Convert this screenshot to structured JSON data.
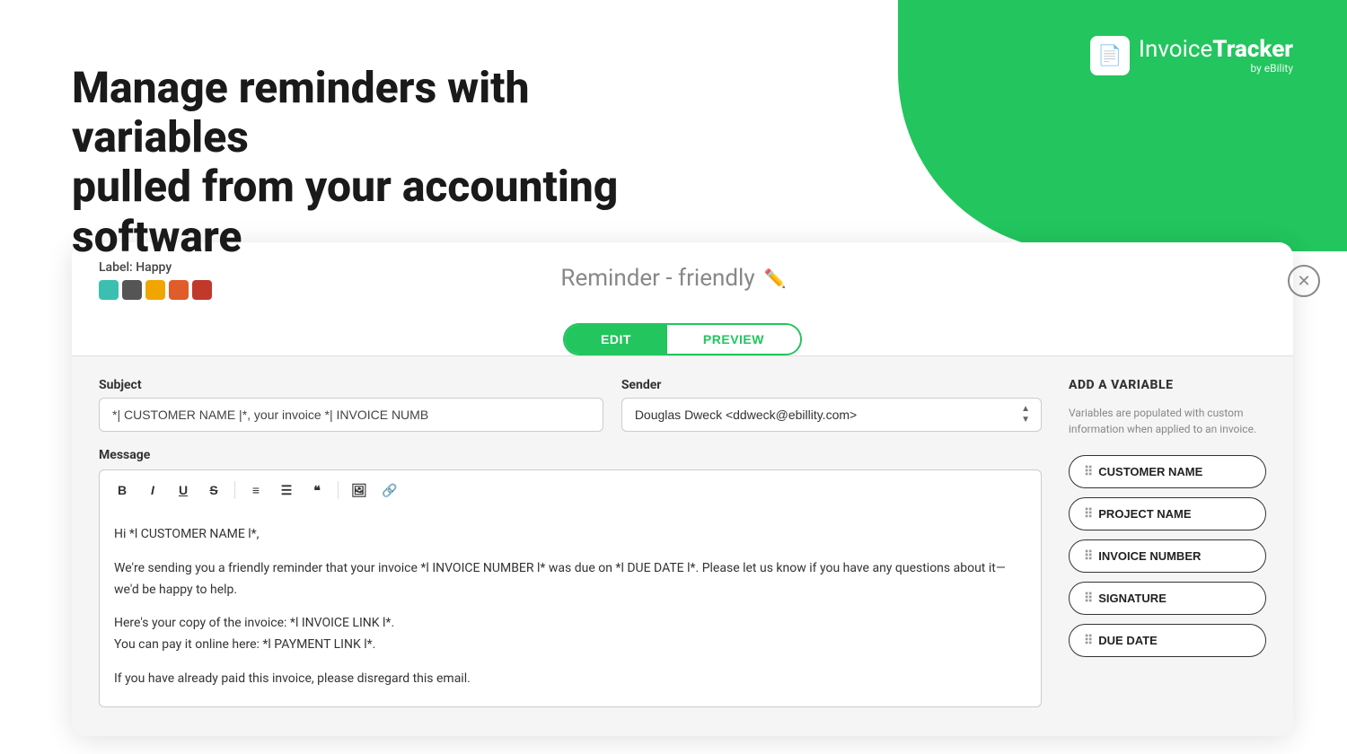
{
  "app": {
    "logo_icon": "📄",
    "logo_name_prefix": "Invoice",
    "logo_name_suffix": "Tracker",
    "logo_by": "by eBility"
  },
  "hero": {
    "heading_line1": "Manage reminders with variables",
    "heading_line2": "pulled from your accounting software"
  },
  "card": {
    "label_text": "Label: Happy",
    "swatches": [
      {
        "color": "#3bbfb0",
        "name": "teal"
      },
      {
        "color": "#7ab648",
        "name": "dark-gray"
      },
      {
        "color": "#f0a500",
        "name": "yellow"
      },
      {
        "color": "#e05c2a",
        "name": "orange"
      },
      {
        "color": "#c0392b",
        "name": "red"
      }
    ],
    "reminder_title": "Reminder - friendly",
    "tabs": {
      "edit_label": "EDIT",
      "preview_label": "PREVIEW",
      "active": "edit"
    },
    "form": {
      "subject_label": "Subject",
      "subject_value": "*| CUSTOMER NAME |*, your invoice *| INVOICE NUMB",
      "sender_label": "Sender",
      "sender_value": "Douglas Dweck <ddweck@ebillity.com>"
    },
    "message": {
      "label": "Message",
      "toolbar_buttons": [
        "B",
        "I",
        "U",
        "S",
        "ol",
        "ul",
        "quote",
        "img",
        "link"
      ],
      "body_line1": "Hi *l CUSTOMER NAME l*,",
      "body_line2": "We're sending you a friendly reminder that your invoice *l INVOICE NUMBER l* was due on *l DUE DATE l*. Please let us know if you have any questions about it—we'd be happy to help.",
      "body_line3": "Here's your copy of the invoice: *l INVOICE LINK l*.",
      "body_line4": "You can pay it online here: *l PAYMENT LINK l*.",
      "body_line5": "If you have already paid this invoice, please disregard this email."
    },
    "add_variable": {
      "title": "ADD A VARIABLE",
      "description": "Variables are populated with custom information when applied to an invoice.",
      "variables": [
        "CUSTOMER NAME",
        "PROJECT NAME",
        "INVOICE NUMBER",
        "SIGNATURE",
        "DUE DATE"
      ]
    }
  }
}
